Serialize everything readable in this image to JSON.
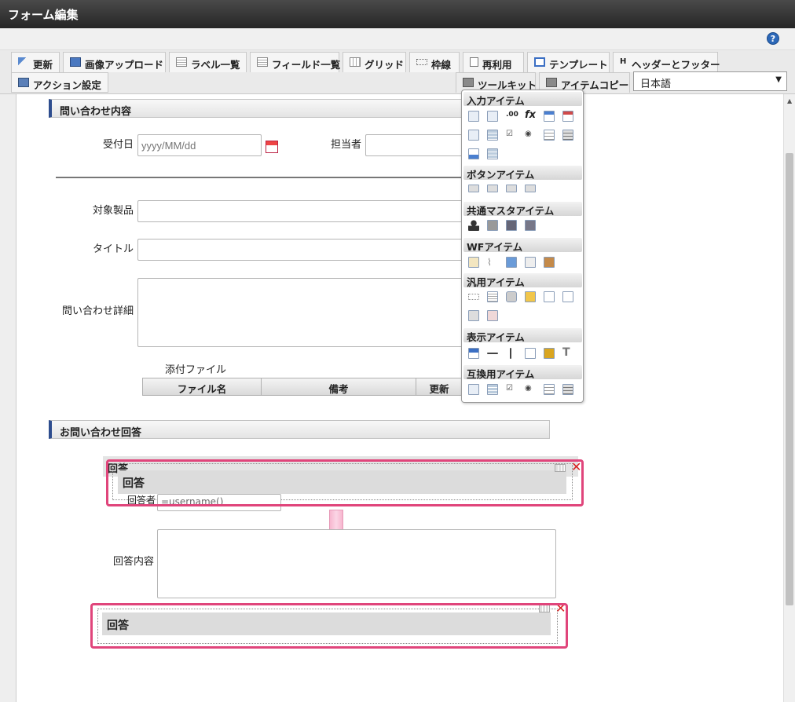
{
  "window_title": "フォーム編集",
  "help_label": "?",
  "toolbar": {
    "row1": [
      "更新",
      "画像アップロード",
      "ラベル一覧",
      "フィールド一覧",
      "グリッド",
      "枠線",
      "再利用",
      "テンプレート",
      "ヘッダーとフッター"
    ],
    "row2_left": "アクション設定",
    "tool_kit": "ツールキット",
    "item_copy": "アイテムコピー",
    "language": "日本語"
  },
  "form": {
    "section1_title": "問い合わせ内容",
    "received_date_label": "受付日",
    "received_date_placeholder": "yyyy/MM/dd",
    "assignee_label": "担当者",
    "product_label": "対象製品",
    "title_label": "タイトル",
    "detail_label": "問い合わせ詳細",
    "attachment_label": "添付ファイル",
    "attachment_columns": [
      "ファイル名",
      "備考",
      "更新"
    ],
    "section2_title": "お問い合わせ回答",
    "answer_header_back": "回答",
    "answer_header": "回答",
    "responder_label": "回答者",
    "responder_value": "=username()",
    "answer_content_label": "回答内容",
    "answer_result_header": "回答"
  },
  "palette": {
    "groups": [
      "入力アイテム",
      "ボタンアイテム",
      "共通マスタアイテム",
      "WFアイテム",
      "汎用アイテム",
      "表示アイテム",
      "互換用アイテム"
    ]
  },
  "colors": {
    "highlight": "#e0457b",
    "section_accent": "#2e4d8e",
    "arrow": "#f4a8c6"
  }
}
